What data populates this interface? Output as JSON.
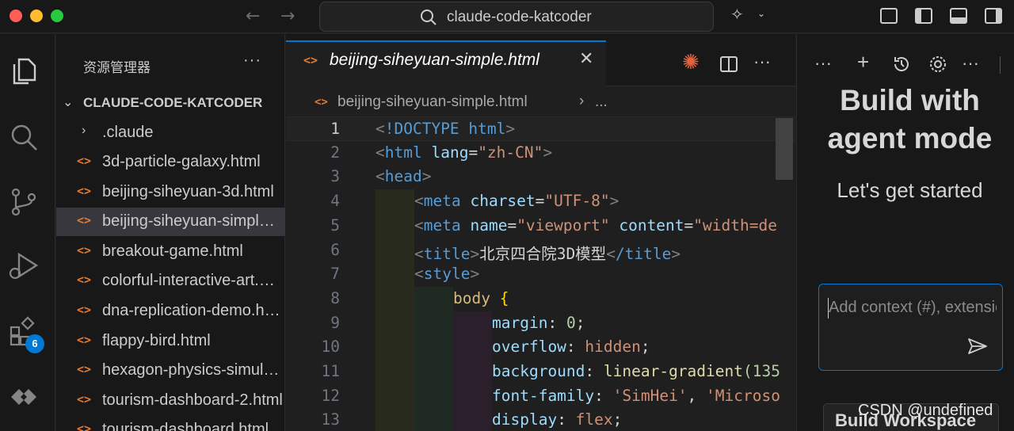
{
  "window": {
    "command_center": "claude-code-katcoder"
  },
  "sidebar": {
    "title": "资源管理器",
    "more_label": "···",
    "folder": "CLAUDE-CODE-KATCODER",
    "items": [
      {
        "name": ".claude",
        "type": "folder"
      },
      {
        "name": "3d-particle-galaxy.html",
        "type": "html"
      },
      {
        "name": "beijing-siheyuan-3d.html",
        "type": "html"
      },
      {
        "name": "beijing-siheyuan-simple.html",
        "type": "html",
        "active": true
      },
      {
        "name": "breakout-game.html",
        "type": "html"
      },
      {
        "name": "colorful-interactive-art.html",
        "type": "html"
      },
      {
        "name": "dna-replication-demo.html",
        "type": "html"
      },
      {
        "name": "flappy-bird.html",
        "type": "html"
      },
      {
        "name": "hexagon-physics-simulation.html",
        "type": "html"
      },
      {
        "name": "tourism-dashboard-2.html",
        "type": "html"
      },
      {
        "name": "tourism-dashboard.html",
        "type": "html"
      }
    ]
  },
  "activity_bar": {
    "extensions_badge": "6"
  },
  "editor": {
    "tab_label": "beijing-siheyuan-simple.html",
    "close_label": "✕",
    "more_label": "···",
    "breadcrumb_file": "beijing-siheyuan-simple.html",
    "breadcrumb_sep": "›",
    "breadcrumb_more": "...",
    "lines": [
      {
        "n": "1"
      },
      {
        "n": "2"
      },
      {
        "n": "3"
      },
      {
        "n": "4"
      },
      {
        "n": "5"
      },
      {
        "n": "6"
      },
      {
        "n": "7"
      },
      {
        "n": "8"
      },
      {
        "n": "9"
      },
      {
        "n": "10"
      },
      {
        "n": "11"
      },
      {
        "n": "12"
      },
      {
        "n": "13"
      }
    ],
    "code": {
      "doctype": "!DOCTYPE html",
      "html_tag": "html",
      "lang_attr": "lang",
      "lang_val": "\"zh-CN\"",
      "head_tag": "head",
      "meta_tag": "meta",
      "charset_attr": "charset",
      "charset_val": "\"UTF-8\"",
      "name_attr": "name",
      "name_val": "\"viewport\"",
      "content_attr": "content",
      "content_val": "\"width=de",
      "title_tag": "title",
      "title_text": "北京四合院3D模型",
      "title_close": "/title",
      "style_tag": "style",
      "body_sel": "body",
      "brace": "{",
      "p_margin": "margin",
      "v_margin": "0",
      "p_overflow": "overflow",
      "v_overflow": "hidden",
      "p_background": "background",
      "v_background_fn": "linear-gradient",
      "v_background_arg": "(135",
      "p_font": "font-family",
      "v_font1": "'SimHei'",
      "v_font2": "'Microso",
      "p_display": "display",
      "v_display": "flex"
    }
  },
  "chat": {
    "title": "Build with agent mode",
    "subtitle": "Let's get started",
    "input_placeholder": "Add context (#), extensions (@), commands (/)",
    "build_button": "Build Workspace",
    "more_label": "···",
    "new_label": "+",
    "watermark": "CSDN @undefined"
  }
}
